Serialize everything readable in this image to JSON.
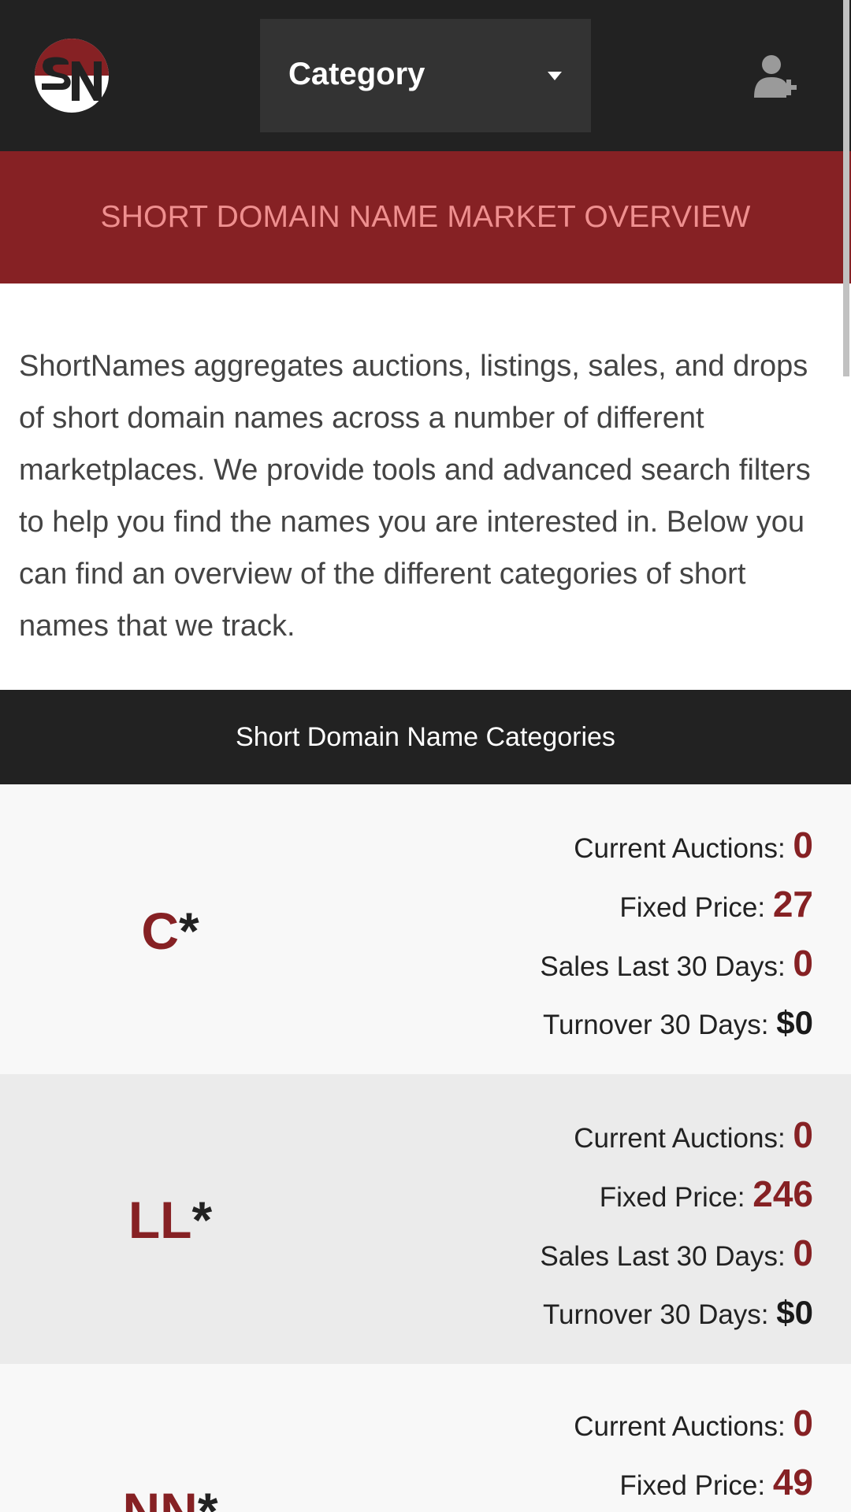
{
  "header": {
    "logo_text": "SN",
    "category_label": "Category",
    "icons": {
      "logo": "sn-logo-icon",
      "caret": "caret-down-icon",
      "user": "user-plus-icon"
    }
  },
  "banner": {
    "title": "SHORT DOMAIN NAME MARKET OVERVIEW"
  },
  "intro": {
    "text": "ShortNames aggregates auctions, listings, sales, and drops of short domain names across a number of different marketplaces. We provide tools and advanced search filters to help you find the names you are interested in. Below you can find an overview of the different categories of short names that we track."
  },
  "categories_section": {
    "title": "Short Domain Name Categories",
    "labels": {
      "current_auctions": "Current Auctions:",
      "fixed_price": "Fixed Price:",
      "sales": "Sales Last 30 Days:",
      "turnover": "Turnover 30 Days:"
    },
    "items": [
      {
        "name": "C",
        "suffix": "*",
        "current_auctions": "0",
        "fixed_price": "27",
        "sales": "0",
        "turnover": "$0"
      },
      {
        "name": "LL",
        "suffix": "*",
        "current_auctions": "0",
        "fixed_price": "246",
        "sales": "0",
        "turnover": "$0"
      },
      {
        "name": "NN",
        "suffix": "*",
        "current_auctions": "0",
        "fixed_price": "49"
      }
    ]
  },
  "colors": {
    "header_bg": "#222222",
    "select_bg": "#333333",
    "brand_red": "#862124",
    "banner_text": "#ef8f8f",
    "row_light": "#f8f8f8",
    "row_dark": "#ebebeb"
  }
}
